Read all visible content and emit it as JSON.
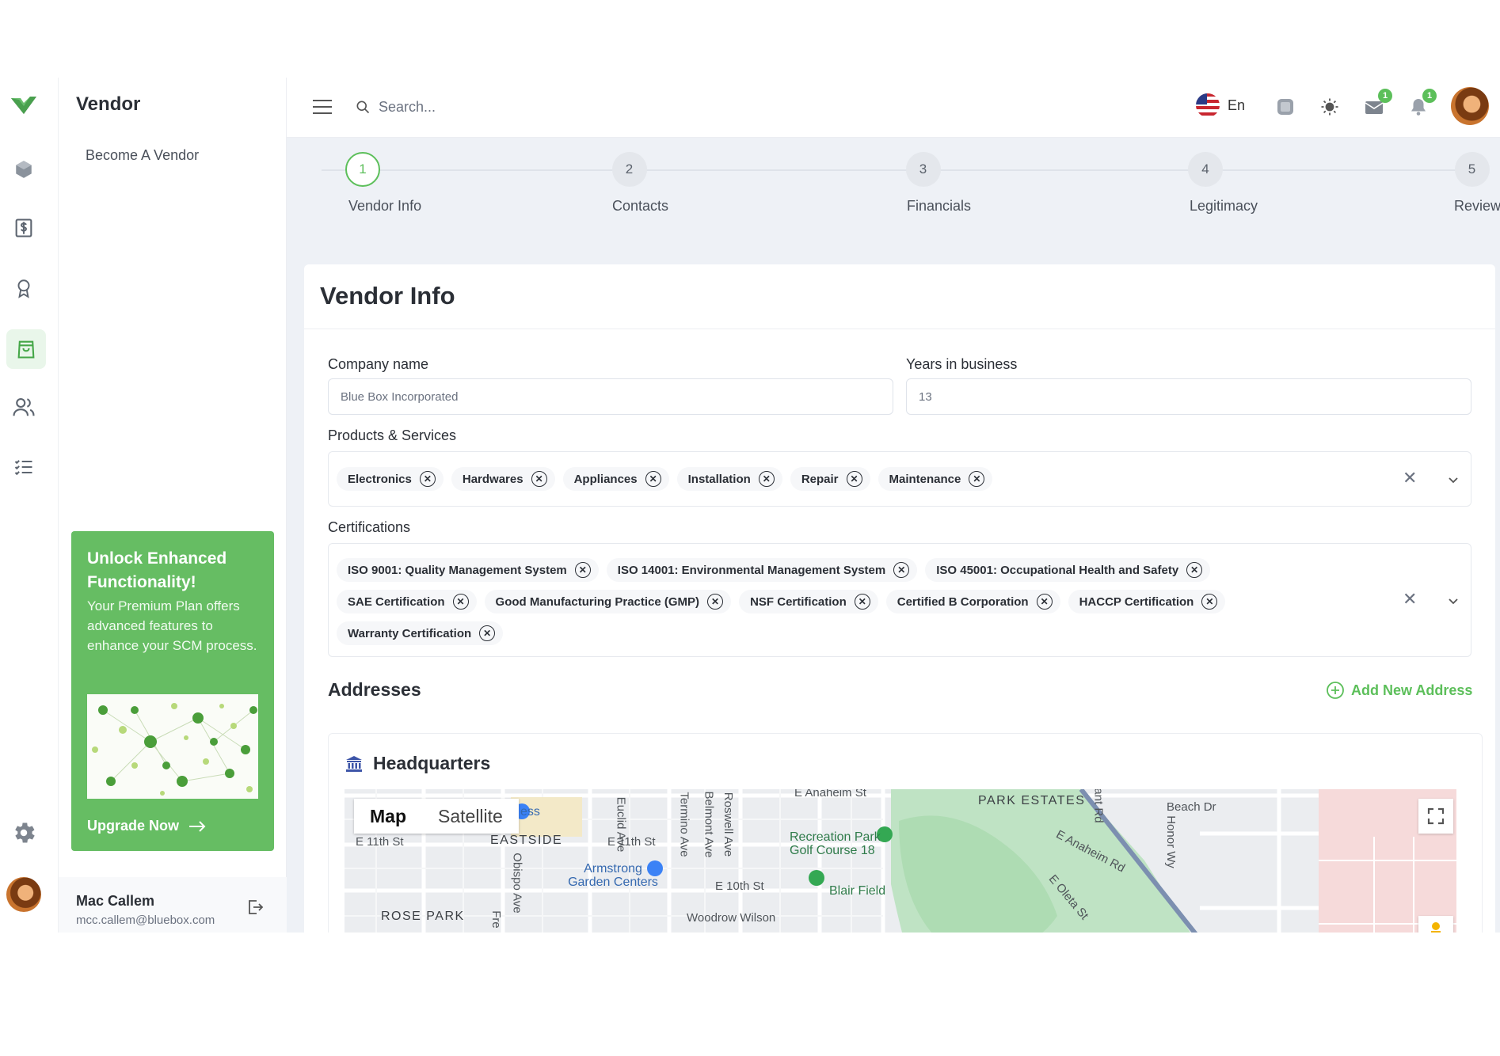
{
  "sidebar": {
    "title": "Vendor",
    "menu_item": "Become A Vendor",
    "rail_icons": [
      "logo",
      "cube-icon",
      "dollar-doc-icon",
      "award-icon",
      "shopping-bag-icon",
      "users-icon",
      "checklist-icon",
      "gear-icon"
    ],
    "promo": {
      "title": "Unlock Enhanced Functionality!",
      "text": "Your Premium Plan offers advanced features to enhance your SCM process.",
      "button": "Upgrade Now"
    },
    "user": {
      "name": "Mac Callem",
      "email": "mcc.callem@bluebox.com"
    }
  },
  "topbar": {
    "search_placeholder": "Search...",
    "language": "En",
    "mail_badge": "1",
    "bell_badge": "1"
  },
  "stepper": {
    "steps": [
      {
        "num": "1",
        "label": "Vendor Info",
        "active": true
      },
      {
        "num": "2",
        "label": "Contacts",
        "active": false
      },
      {
        "num": "3",
        "label": "Financials",
        "active": false
      },
      {
        "num": "4",
        "label": "Legitimacy",
        "active": false
      },
      {
        "num": "5",
        "label": "Review",
        "active": false
      }
    ]
  },
  "form": {
    "title": "Vendor Info",
    "company_label": "Company name",
    "company_value": "Blue Box Incorporated",
    "years_label": "Years in business",
    "years_value": "13",
    "products_label": "Products & Services",
    "products": [
      "Electronics",
      "Hardwares",
      "Appliances",
      "Installation",
      "Repair",
      "Maintenance"
    ],
    "certs_label": "Certifications",
    "certifications": [
      "ISO 9001: Quality Management System",
      "ISO 14001: Environmental Management System",
      "ISO 45001: Occupational Health and Safety",
      "SAE Certification",
      "Good Manufacturing Practice (GMP)",
      "NSF Certification",
      "Certified B Corporation",
      "HACCP Certification",
      "Warranty Certification"
    ],
    "addresses_label": "Addresses",
    "add_address": "Add New Address",
    "hq_label": "Headquarters"
  },
  "map": {
    "toggle_map": "Map",
    "toggle_satellite": "Satellite",
    "labels": {
      "anaheim": "E Anaheim St",
      "park_estates": "PARK ESTATES",
      "beach_dr": "Beach Dr",
      "eleventh_w": "E 11th St",
      "eastside": "EASTSIDE",
      "eleventh_e": "E 11th St",
      "recreation": "Recreation Park Golf Course 18",
      "anaheim_rd": "E Anaheim Rd",
      "armstrong": "Armstrong Garden Centers",
      "tenth": "E 10th St",
      "blair": "Blair Field",
      "rose_park": "ROSE PARK",
      "woodrow": "Woodrow Wilson",
      "obispo": "Obispo Ave",
      "euclid": "Euclid Ave",
      "termino": "Termino Ave",
      "belmont": "Belmont Ave",
      "roswell": "Roswell Ave",
      "oleta": "E Oleta St",
      "honor": "Honor Wy",
      "grant_rd": "ant Rd",
      "ess": "ess",
      "fre": "Fre"
    }
  },
  "colors": {
    "accent": "#5cbf5a",
    "promo_bg": "#66bd63",
    "content_bg": "#eef1f6"
  }
}
